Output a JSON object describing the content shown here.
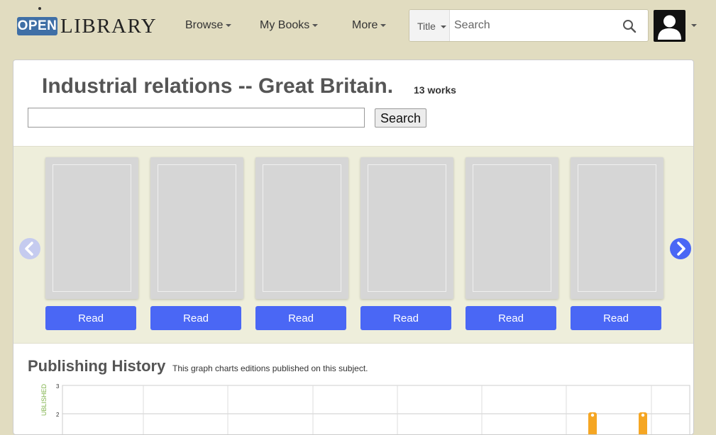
{
  "header": {
    "logo_open": "OPEN",
    "logo_library": "LIBRARY",
    "nav": [
      {
        "label": "Browse"
      },
      {
        "label": "My Books"
      },
      {
        "label": "More"
      }
    ],
    "search": {
      "type_label": "Title",
      "placeholder": "Search"
    },
    "colors": {
      "logo_blue": "#3f6fa6",
      "background": "#e1dcc0"
    }
  },
  "subject": {
    "title": "Industrial relations -- Great Britain.",
    "work_count": "13 works",
    "search_button": "Search"
  },
  "carousel": {
    "books": [
      {
        "button_label": "Read"
      },
      {
        "button_label": "Read"
      },
      {
        "button_label": "Read"
      },
      {
        "button_label": "Read"
      },
      {
        "button_label": "Read"
      },
      {
        "button_label": "Read"
      }
    ],
    "colors": {
      "read_button": "#4a67f5",
      "arrow": "#4a67f5"
    }
  },
  "publishing_history": {
    "heading": "Publishing History",
    "description": "This graph charts editions published on this subject.",
    "chart_data": {
      "type": "bar",
      "ylabel": "UBLISHED",
      "yticks": [
        "3",
        "2"
      ],
      "ylim_visible": [
        2,
        3
      ],
      "grid": true,
      "marker_color": "#f5a623"
    }
  }
}
